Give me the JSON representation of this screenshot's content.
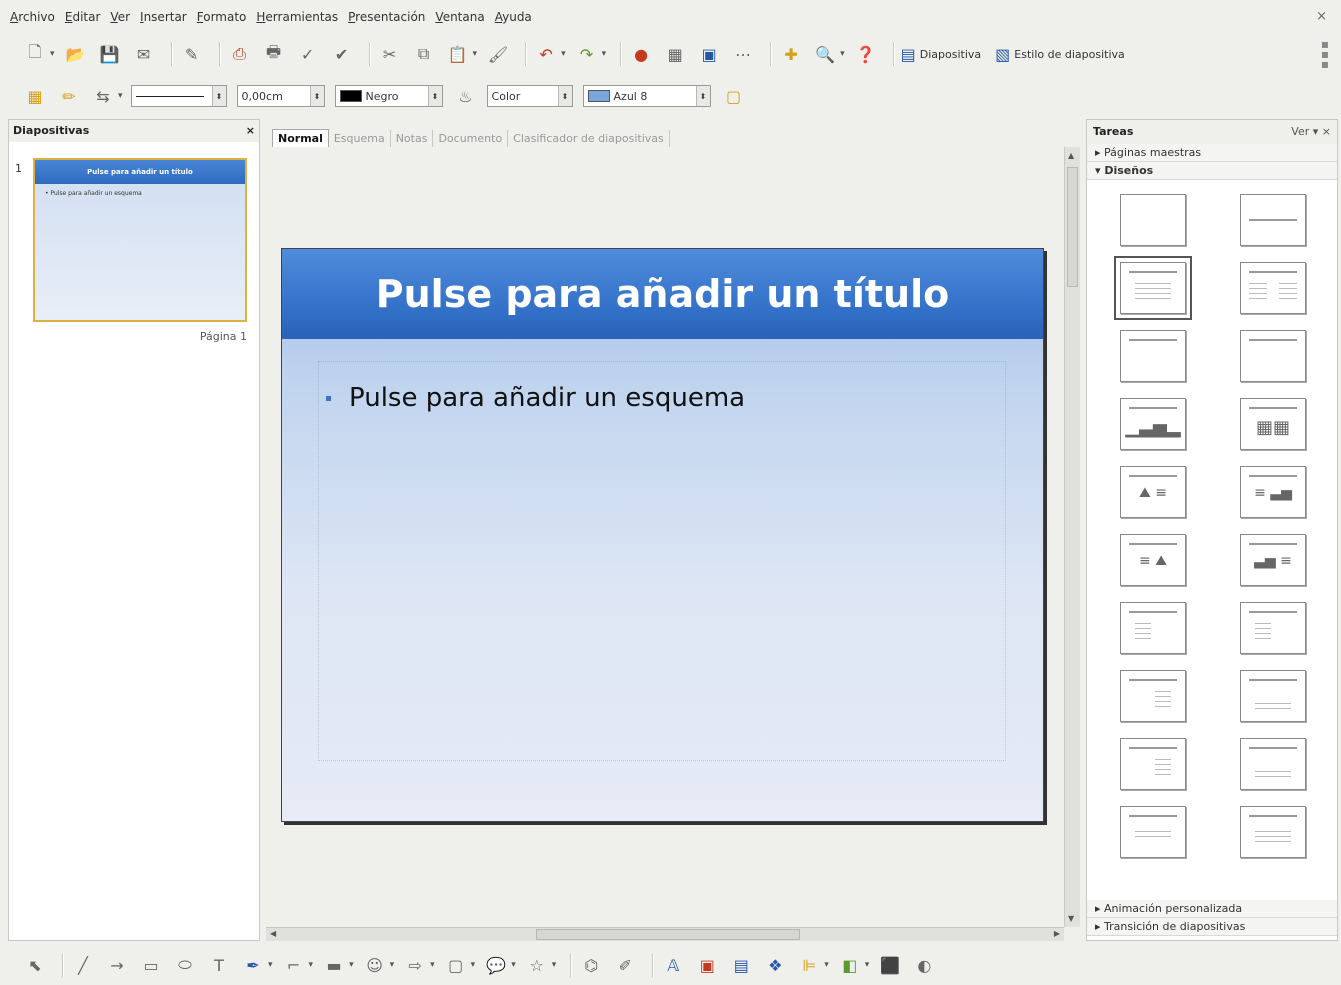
{
  "menu": [
    "Archivo",
    "Editar",
    "Ver",
    "Insertar",
    "Formato",
    "Herramientas",
    "Presentación",
    "Ventana",
    "Ayuda"
  ],
  "window_close": "×",
  "toolbar1": {
    "slide_button": "Diapositiva",
    "slide_style_button": "Estilo de diapositiva"
  },
  "toolbar2": {
    "line_width": "0,00cm",
    "line_color": "Negro",
    "line_color_hex": "#000000",
    "area_style": "Color",
    "area_color": "Azul 8",
    "area_color_hex": "#7aa6e0"
  },
  "slides_panel": {
    "title": "Diapositivas",
    "close": "×",
    "slide_number": "1",
    "thumb_title": "Pulse para añadir un título",
    "thumb_bullet": "• Pulse para añadir un esquema",
    "page_label": "Página 1"
  },
  "tabs": [
    "Normal",
    "Esquema",
    "Notas",
    "Documento",
    "Clasificador de diapositivas"
  ],
  "slide": {
    "title": "Pulse para añadir un título",
    "bullet": "Pulse para añadir un esquema"
  },
  "tasks_panel": {
    "title": "Tareas",
    "view_menu": "Ver",
    "close": "×",
    "sections": {
      "master_pages": "Páginas maestras",
      "layouts": "Diseños",
      "custom_animation": "Animación personalizada",
      "slide_transition": "Transición de diapositivas"
    }
  }
}
